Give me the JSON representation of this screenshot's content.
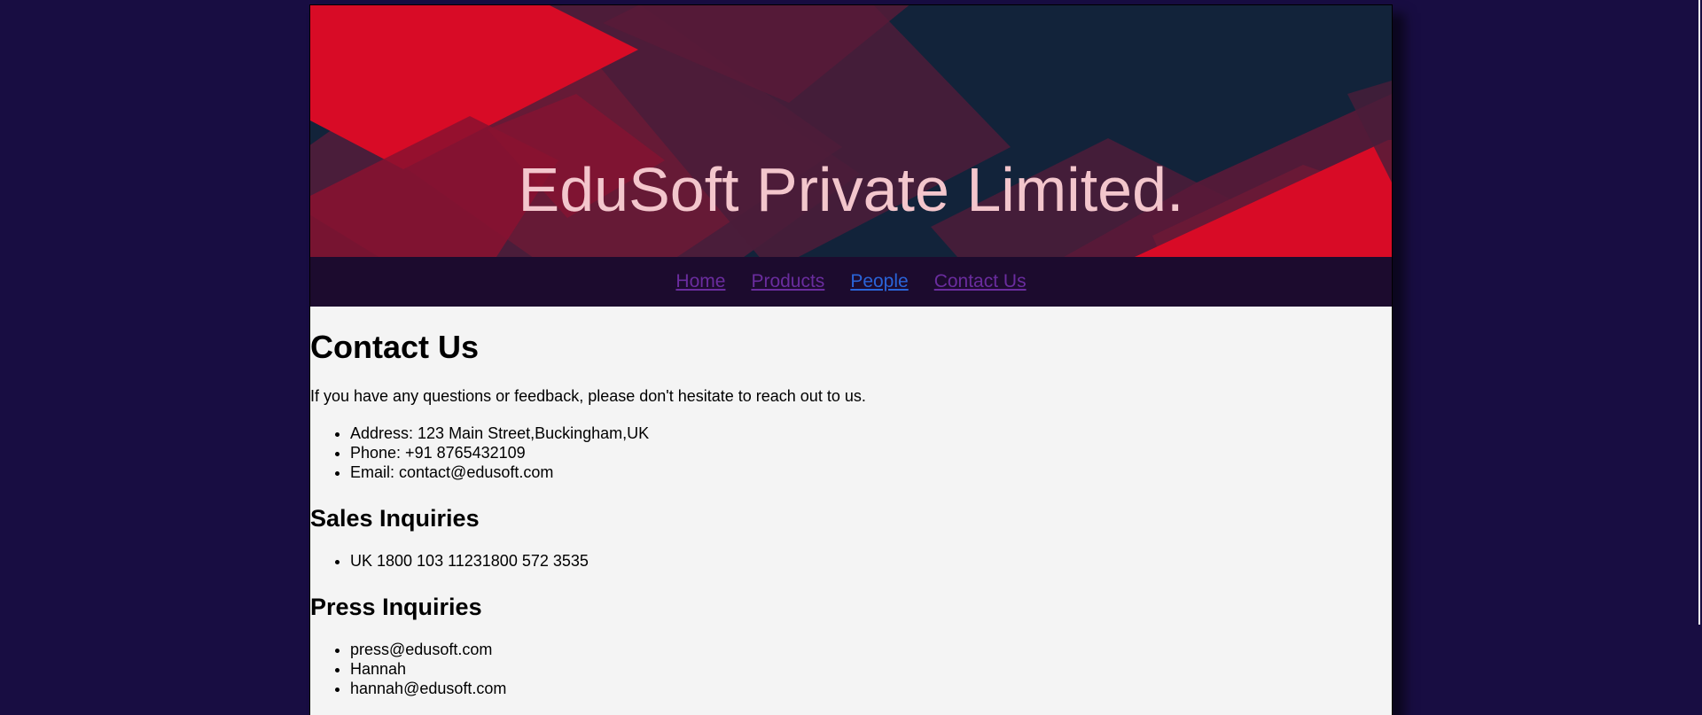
{
  "header": {
    "title": "EduSoft Private Limited."
  },
  "nav": {
    "items": [
      {
        "label": "Home",
        "state": "visited"
      },
      {
        "label": "Products",
        "state": "visited"
      },
      {
        "label": "People",
        "state": "active"
      },
      {
        "label": "Contact Us",
        "state": "visited"
      }
    ]
  },
  "main": {
    "heading": "Contact Us",
    "intro": "If you have any questions or feedback, please don't hesitate to reach out to us.",
    "contact_items": [
      "Address: 123 Main Street,Buckingham,UK",
      "Phone: +91 8765432109",
      "Email: contact@edusoft.com"
    ],
    "sales": {
      "heading": "Sales Inquiries",
      "items": [
        "UK 1800 103 11231800 572 3535"
      ]
    },
    "press": {
      "heading": "Press Inquiries",
      "items": [
        "press@edusoft.com",
        "Hannah",
        "hannah@edusoft.com"
      ]
    }
  },
  "colors": {
    "page_background": "#180d42",
    "banner_background": "#12233a",
    "banner_red": "#d80b26",
    "title_text": "#f3c6cc",
    "nav_background": "#1c0b2e",
    "link_visited": "#6a2c9e",
    "link_active": "#2a64d8",
    "content_background": "#f4f4f4"
  }
}
